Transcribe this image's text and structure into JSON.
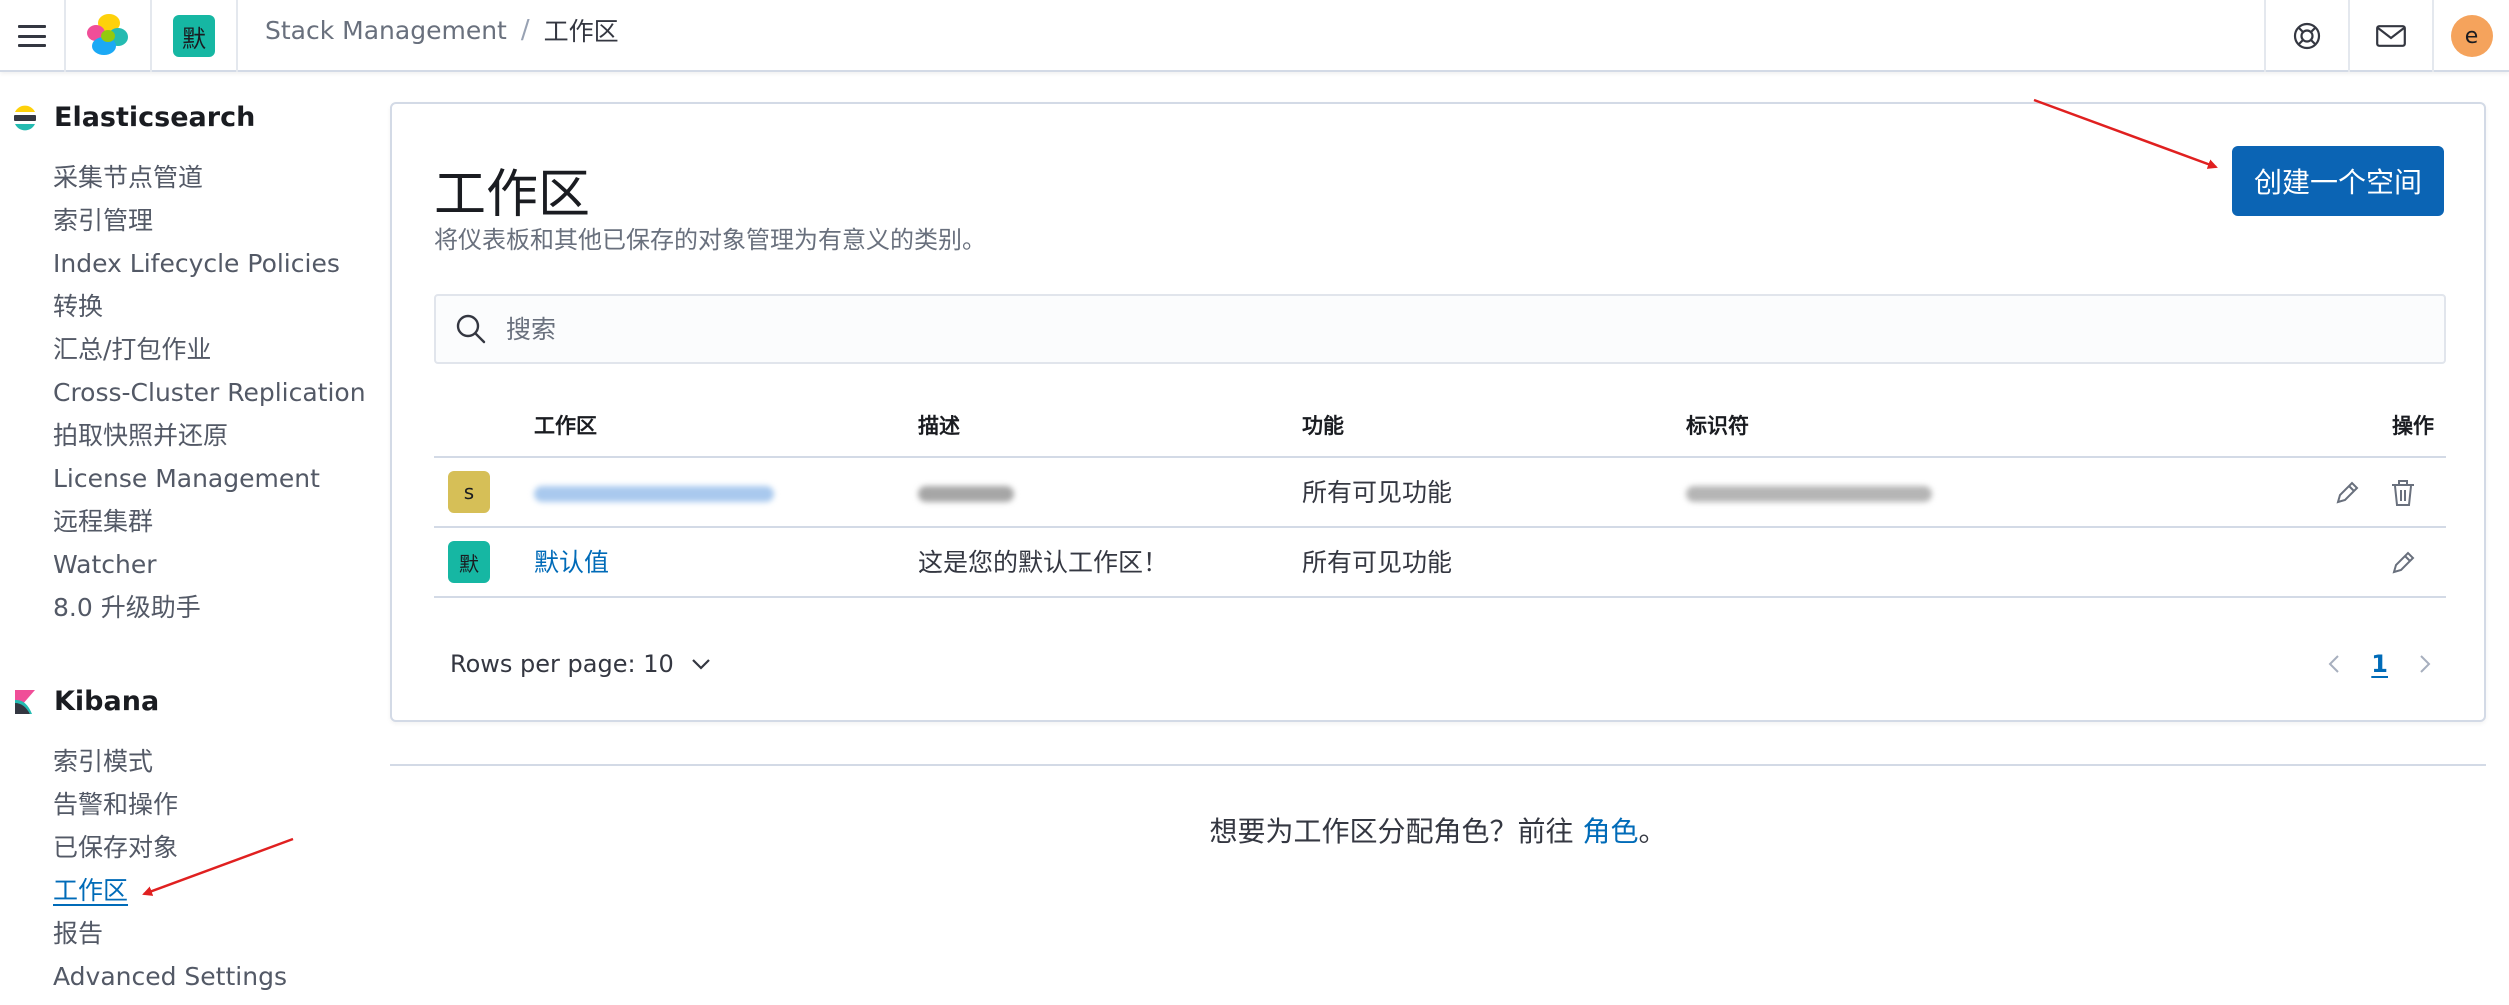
{
  "header": {
    "space_initial": "默",
    "breadcrumbs": [
      "Stack Management",
      "工作区"
    ],
    "avatar_initial": "e"
  },
  "sidebar": {
    "groups": [
      {
        "title": "Elasticsearch",
        "items": [
          "采集节点管道",
          "索引管理",
          "Index Lifecycle Policies",
          "转换",
          "汇总/打包作业",
          "Cross-Cluster Replication",
          "拍取快照并还原",
          "License Management",
          "远程集群",
          "Watcher",
          "8.0 升级助手"
        ]
      },
      {
        "title": "Kibana",
        "items": [
          "索引模式",
          "告警和操作",
          "已保存对象",
          "工作区",
          "报告",
          "Advanced Settings"
        ],
        "active_index": 3
      }
    ]
  },
  "main": {
    "title": "工作区",
    "description": "将仪表板和其他已保存的对象管理为有意义的类别。",
    "create_button": "创建一个空间",
    "search": {
      "placeholder": "搜索",
      "value": ""
    },
    "table": {
      "columns": [
        "工作区",
        "描述",
        "功能",
        "标识符",
        "操作"
      ],
      "rows": [
        {
          "avatar": "s",
          "avatar_color": "#d6bf57",
          "name": "",
          "description": "",
          "features": "所有可见功能",
          "identifier": "",
          "actions": [
            "edit",
            "delete"
          ]
        },
        {
          "avatar": "默",
          "avatar_color": "#16b7a3",
          "name": "默认值",
          "description": "这是您的默认工作区！",
          "features": "所有可见功能",
          "identifier": "",
          "actions": [
            "edit"
          ]
        }
      ]
    },
    "pagination": {
      "rows_per_page_label": "Rows per page: 10",
      "current_page": "1"
    },
    "roles_note": {
      "prefix": "想要为工作区分配角色？前往 ",
      "link": "角色",
      "suffix": "。"
    }
  },
  "colors": {
    "primary": "#0b64b4",
    "link": "#006bb8",
    "annotation_arrow": "#e02020"
  }
}
